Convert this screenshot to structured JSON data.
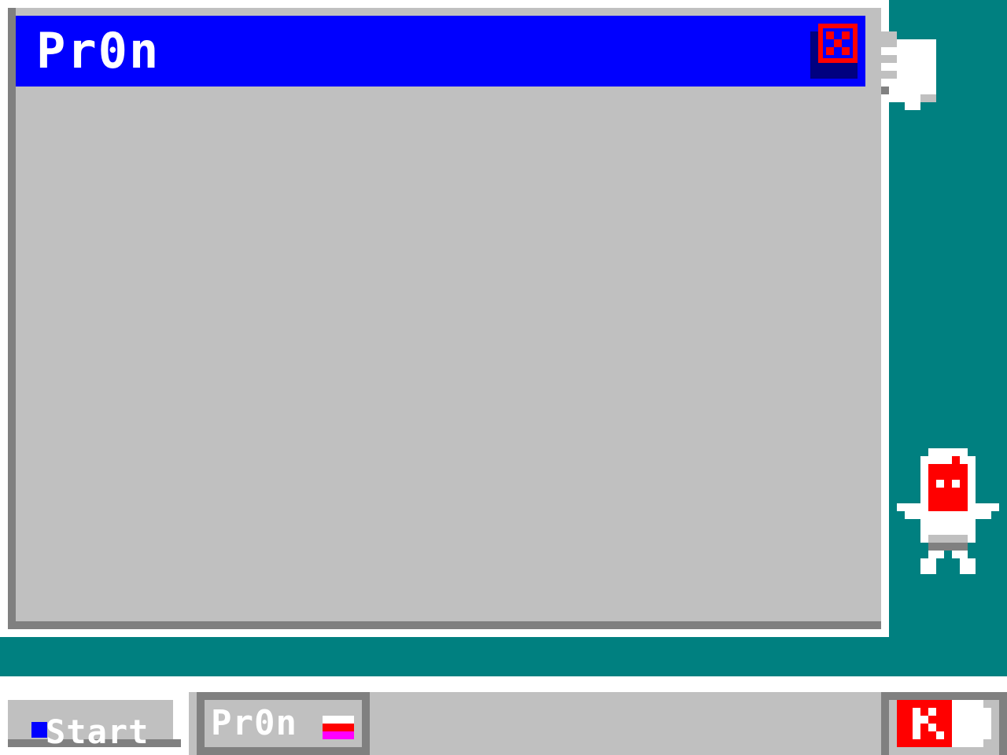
{
  "window": {
    "title": "Pr0n",
    "close_icon": "close-icon"
  },
  "taskbar": {
    "start_label": "Start",
    "task_label": "Pr0n"
  },
  "colors": {
    "desktop": "#008080",
    "titlebar": "#0000ff",
    "window_face": "#c0c0c0",
    "shadow": "#808080",
    "accent_red": "#ff0000",
    "accent_magenta": "#ff00ff"
  }
}
